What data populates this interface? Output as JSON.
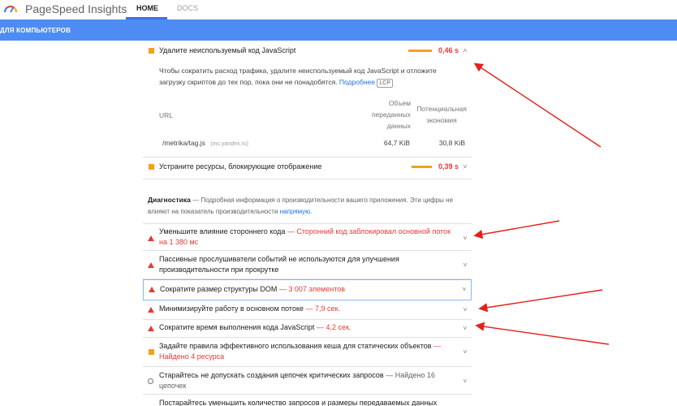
{
  "header": {
    "app_title": "PageSpeed Insights",
    "tabs": [
      {
        "label": "HOME",
        "active": true
      },
      {
        "label": "DOCS",
        "active": false
      }
    ]
  },
  "banner": {
    "label": "ДЛЯ КОМПЬЮТЕРОВ",
    "color": "#4e8cf3"
  },
  "opportunities": [
    {
      "title": "Удалите неиспользуемый код JavaScript",
      "value": "0,46 s",
      "severity": "average",
      "expanded": true,
      "description": "Чтобы сократить расход трафика, удалите неиспользуемый код JavaScript и отложите загрузку скриптов до тех пор, пока они не понадобятся.",
      "learn_more": "Подробнее",
      "tag": "LCP",
      "table": {
        "headers": [
          "URL",
          "Объем переданных данных",
          "Потенциальная экономия"
        ],
        "rows": [
          {
            "url": "/metrika/tag.js",
            "host": "(mc.yandex.ru)",
            "transfer": "64,7 KiB",
            "savings": "30,8 KiB"
          }
        ]
      }
    },
    {
      "title": "Устраните ресурсы, блокирующие отображение",
      "value": "0,39 s",
      "severity": "average",
      "expanded": false
    }
  ],
  "diagnostics": {
    "title": "Диагностика",
    "description": "Подробная информация о производительности вашего приложения. Эти цифры не влияют на показатель производительности",
    "link": "напрямую",
    "items": [
      {
        "title": "Уменьшите влияние стороннего кода",
        "detail": "Сторонний код заблокировал основной поток на 1 380 мс",
        "severity": "fail"
      },
      {
        "title": "Пассивные прослушиватели событий не используются для улучшения производительности при прокрутке",
        "detail": "",
        "severity": "fail"
      },
      {
        "title": "Сократите размер структуры DOM",
        "detail": "3 007 элементов",
        "severity": "fail"
      },
      {
        "title": "Минимизируйте работу в основном потоке",
        "detail": "7,9 сек.",
        "severity": "fail"
      },
      {
        "title": "Сократите время выполнения кода JavaScript",
        "detail": "4,2 сек.",
        "severity": "fail"
      },
      {
        "title": "Задайте правила эффективного использования кеша для статических объектов",
        "detail": "Найдено 4 ресурса",
        "severity": "average"
      },
      {
        "title": "Старайтесь не допускать создания цепочек критических запросов",
        "detail": "Найдено 16 цепочек",
        "severity": "info"
      },
      {
        "title": "Постарайтесь уменьшить количество запросов и размеры передаваемых данных",
        "detail": "",
        "severity": "info"
      }
    ]
  },
  "colors": {
    "fail": "#e53935",
    "average": "#f4a020",
    "annotation_arrow": "#e5201c"
  }
}
